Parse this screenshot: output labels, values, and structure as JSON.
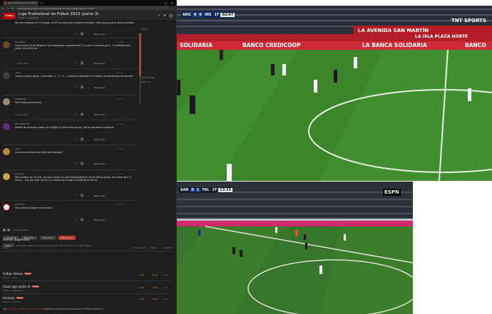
{
  "browser": {
    "tab_title": "Liga Profesional de Fútbol 2",
    "new_tab": "+",
    "url": "ar.fuegodelmundo.com/t/liga-profesional-de-futbol-2023-parte-3/12347"
  },
  "forum": {
    "logo_text": "FUEGO",
    "topic_title": "Liga Profesional de Fútbol 2023 (parte 3)",
    "topic_category": "Fútbol • Argentina",
    "timeline_top": "20 oct",
    "timeline_pos": "3776 / 5214",
    "timeline_sub": "hace 1 h"
  },
  "posts": [
    {
      "user": "",
      "time": "",
      "body": "No veo cambios en el equipo, el DT ya tiene los titulares armados. Todo igual que la fecha pasada."
    },
    {
      "user": "DanyMess",
      "time": "1 min",
      "body": "Como pinta lo de Rosario? Lo tendremos nuevamente? La Lepra la rompe ya 3 - 0 Instituto pero mejor sin mirar ya."
    },
    {
      "user": "_Kalli",
      "time": "1 min",
      "body": "Como ya paro ganar 0 partidos, 0 - 0 - 0... y seguirá saliendo en la tabla de posiciones del torneo."
    },
    {
      "user": "LitoBengel",
      "time": "1 min",
      "body": "Pero tenía ganas loco!"
    },
    {
      "user": "FalcaRoja102",
      "time": "1 min",
      "body": "Pelota de Ascenso como va el Rojo? Lo de el otro grupo, tiene que estar cuidando."
    },
    {
      "user": "_Jaco",
      "time": "1 min",
      "body": "¿Los tres arbitros que leés de Instituto?"
    },
    {
      "user": "LuisGrau",
      "time": "1 min",
      "body": "Nóli porque se ríe mal, ya vas a estar en que Independiente no ha hecho goles, que esto da 0 a mano... Los siempre Lanús y el mismo que jugó a mitad de la fecha."
    },
    {
      "user": "psusomo",
      "time": "1 min",
      "body": "Hoy vamos a jugar con la cara."
    }
  ],
  "post_actions": {
    "reply": "Responder",
    "replies_count": "1 Respuesta"
  },
  "bottom": {
    "users_label": "+ participantes",
    "buttons": [
      "Compartir",
      "Marcador",
      "Denunciar",
      "Responder"
    ],
    "notify_label": "Seguir",
    "notify_text": "Recibirás notificaciones si alguien responde o menciona tu @nombre."
  },
  "suggested": {
    "title": "Temas sugeridos",
    "col_topic": "Tema",
    "col_replies": "Respuestas",
    "col_views": "Vistas",
    "col_activity": "Actividad",
    "rows": [
      {
        "title": "Fútbol chileno",
        "badge": "Nuevo",
        "category": "Fútbol • Chile",
        "replies": "2.4k",
        "views": "97.0k",
        "activity": "1d"
      },
      {
        "title": "Copa Liga (parte 2)",
        "badge": "Nuevo",
        "category": "Fútbol • Argentina",
        "replies": "1.5k",
        "views": "23.9k",
        "activity": "3d"
      },
      {
        "title": "Ascenso",
        "badge": "Nuevo",
        "category": "Fútbol • Ascenso",
        "replies": "1.1k",
        "views": "34.1k",
        "activity": "5d"
      }
    ],
    "footer_pre": "Hay",
    "footer_hl1": "158 sin leer",
    "footer_mid": "y",
    "footer_hl2": "7 nuevos temas",
    "footer_post": "restantes, o explora otros temas en Fútbol Argentino"
  },
  "stream1": {
    "team1": "ARG",
    "score1": "0",
    "score2": "0",
    "team2": "INS",
    "period": "1T",
    "clock": "02:47",
    "channel": "TNT SPORTS",
    "ad_left": "SOLIDARIA",
    "ad_mid": "BANCO CREDICOOP",
    "ad_right": "LA BANCA SOLIDARIA",
    "ad_far": "BANCO",
    "top_banner": "LA AVENIDA SAN MARTÍN",
    "top_banner2": "LA ISLA PLAZA NORTE",
    "colors": {
      "pitch": "#3f8f2f",
      "pitch2": "#3a8629",
      "ad_band": "#b21e2a"
    }
  },
  "stream2": {
    "team1": "SAR",
    "score1": "0",
    "score2": "1",
    "team2": "TAL",
    "period": "1T",
    "clock": "13:15",
    "channel": "ESPN",
    "colors": {
      "pitch": "#3b7d2a",
      "band": "#d12a6a"
    }
  }
}
